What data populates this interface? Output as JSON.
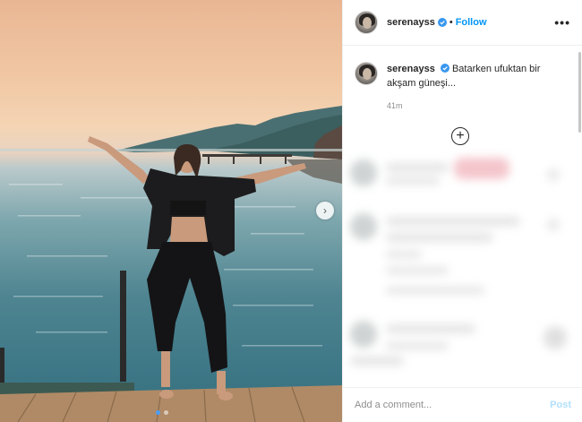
{
  "post": {
    "author": "serenayss",
    "follow_label": "Follow",
    "bullet": "•",
    "more_icon": "more-horizontal-icon",
    "more_glyph": "•••",
    "caption_text": "Batarken ufuktan bir akşam güneşi...",
    "time_ago": "41m",
    "load_more_glyph": "+",
    "nav_next_glyph": "›",
    "carousel": {
      "total": 2,
      "current": 1
    }
  },
  "comment_box": {
    "placeholder": "Add a comment...",
    "post_label": "Post"
  },
  "colors": {
    "accent": "#0095f6",
    "post_disabled": "#b2dffc",
    "verified": "#3897f0",
    "carousel_active_dot": "#4a9ef7"
  }
}
